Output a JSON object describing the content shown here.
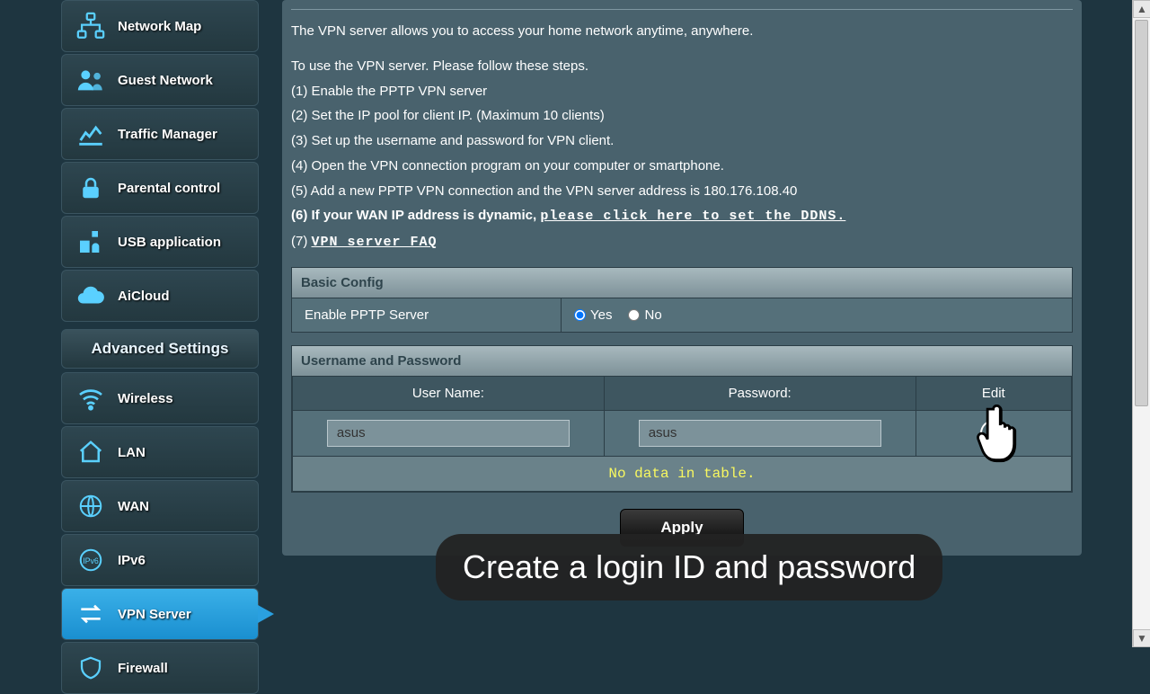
{
  "sidebar": {
    "items": [
      {
        "label": "Network Map",
        "icon": "network-map-icon"
      },
      {
        "label": "Guest Network",
        "icon": "users-icon"
      },
      {
        "label": "Traffic Manager",
        "icon": "chart-icon"
      },
      {
        "label": "Parental control",
        "icon": "lock-icon"
      },
      {
        "label": "USB application",
        "icon": "plugin-icon"
      },
      {
        "label": "AiCloud",
        "icon": "cloud-icon"
      }
    ],
    "advanced_header": "Advanced Settings",
    "advanced_items": [
      {
        "label": "Wireless",
        "icon": "wifi-icon"
      },
      {
        "label": "LAN",
        "icon": "home-icon"
      },
      {
        "label": "WAN",
        "icon": "globe-icon"
      },
      {
        "label": "IPv6",
        "icon": "ipv6-icon"
      },
      {
        "label": "VPN Server",
        "icon": "swap-icon",
        "active": true
      },
      {
        "label": "Firewall",
        "icon": "shield-icon"
      }
    ]
  },
  "intro": {
    "line0": "The VPN server allows you to access your home network anytime, anywhere.",
    "line1": "To use the VPN server. Please follow these steps.",
    "step1": "(1) Enable the PPTP VPN server",
    "step2": "(2) Set the IP pool for client IP. (Maximum 10 clients)",
    "step3": "(3) Set up the username and password for VPN client.",
    "step4": "(4) Open the VPN connection program on your computer or smartphone.",
    "step5": "(5) Add a new PPTP VPN connection and the VPN server address is 180.176.108.40",
    "step6_prefix": "(6) If your WAN IP address is dynamic, ",
    "step6_link": "please click here to set the DDNS.",
    "step7_prefix": "(7) ",
    "step7_link": "VPN server FAQ"
  },
  "basic": {
    "section_title": "Basic Config",
    "enable_label": "Enable PPTP Server",
    "yes": "Yes",
    "no": "No",
    "enable_value": "Yes"
  },
  "userpass": {
    "section_title": "Username and Password",
    "col_username": "User Name:",
    "col_password": "Password:",
    "col_edit": "Edit",
    "username_value": "asus",
    "password_value": "asus",
    "no_data": "No data in table."
  },
  "apply_label": "Apply",
  "overlay_tip": "Create a login ID and password"
}
